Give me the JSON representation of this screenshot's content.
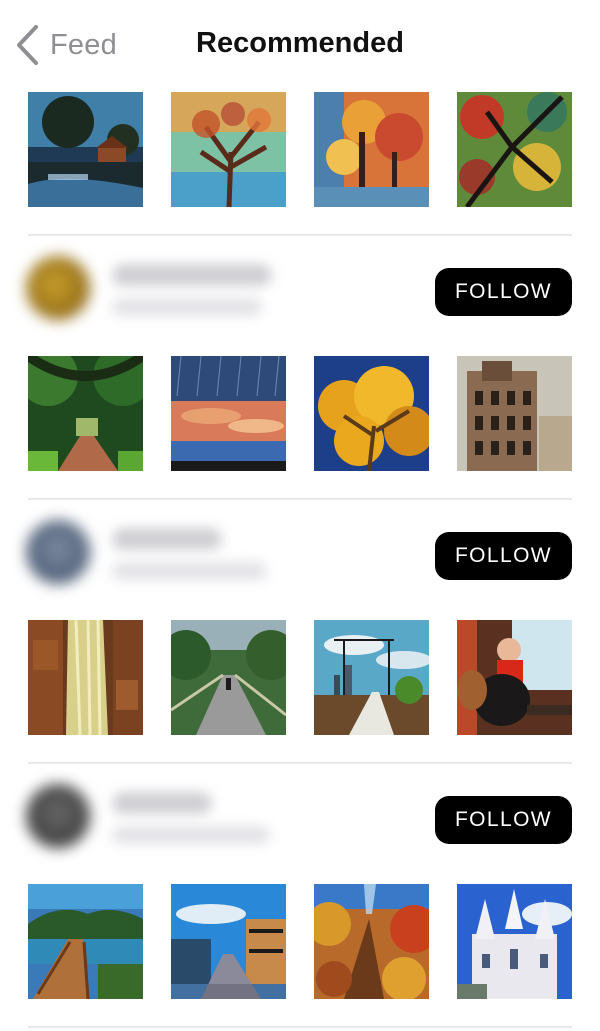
{
  "nav": {
    "back_label": "Feed",
    "title": "Recommended"
  },
  "top_thumbnails": [
    {
      "icon": "moonlit-house-painting"
    },
    {
      "icon": "colorful-tree-painting"
    },
    {
      "icon": "autumn-forest-painting"
    },
    {
      "icon": "tree-canopy-painting"
    }
  ],
  "users": [
    {
      "avatar_color": "#a6801e",
      "follow_label": "FOLLOW",
      "thumbnails": [
        {
          "icon": "forest-tunnel-path"
        },
        {
          "icon": "sunset-sky-rain"
        },
        {
          "icon": "yellow-autumn-tree"
        },
        {
          "icon": "ornate-building"
        }
      ]
    },
    {
      "avatar_color": "#5a6b84",
      "follow_label": "FOLLOW",
      "thumbnails": [
        {
          "icon": "waterfall-rocks"
        },
        {
          "icon": "bridge-walkway"
        },
        {
          "icon": "railroad-tracks-city"
        },
        {
          "icon": "child-with-dog-window"
        }
      ]
    },
    {
      "avatar_color": "#4b4b4b",
      "follow_label": "FOLLOW",
      "thumbnails": [
        {
          "icon": "wooden-boardwalk-lake"
        },
        {
          "icon": "city-street-blue-sky"
        },
        {
          "icon": "autumn-canyon"
        },
        {
          "icon": "white-cathedral"
        }
      ]
    }
  ]
}
